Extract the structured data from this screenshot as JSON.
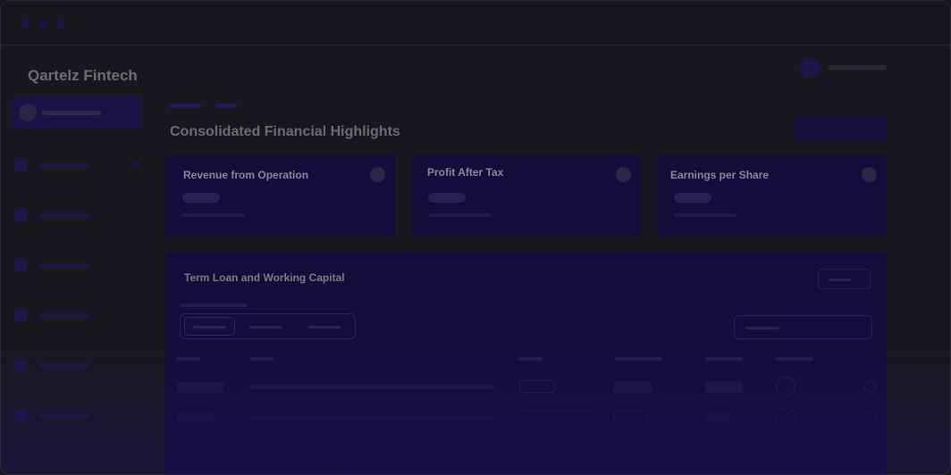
{
  "app": {
    "brand": "Qartelz Fintech"
  },
  "page": {
    "title": "Consolidated Financial Highlights"
  },
  "cards": [
    {
      "title": "Revenue from Operation"
    },
    {
      "title": "Profit After Tax"
    },
    {
      "title": "Earnings per Share"
    }
  ],
  "panel": {
    "title": "Term Loan and Working Capital"
  },
  "colors": {
    "background": "#19171d",
    "card": "#140c3a",
    "panel": "#150c3b",
    "accent": "#1a1144"
  },
  "icons": [
    "window-dot-icon",
    "avatar-icon",
    "sidebar-nav-icon",
    "card-info-icon",
    "chevron-icon"
  ]
}
